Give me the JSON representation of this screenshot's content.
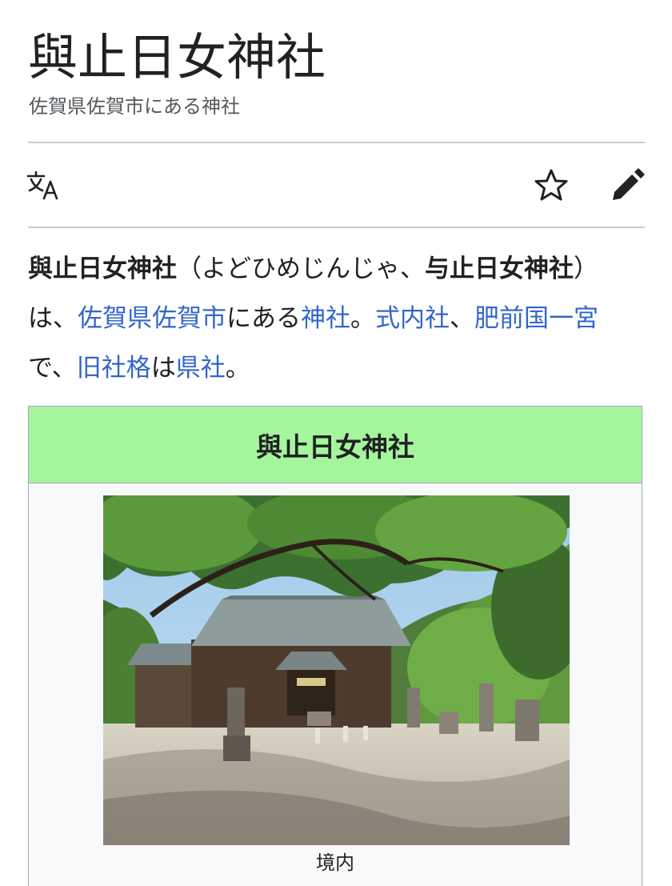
{
  "article": {
    "title": "與止日女神社",
    "description": "佐賀県佐賀市にある神社"
  },
  "toolbar": {
    "language_icon": "translate-icon",
    "watch_icon": "star-icon",
    "edit_icon": "pencil-icon"
  },
  "lead": {
    "t1": "與止日女神社",
    "t2": "（よどひめじんじゃ、",
    "t3": "与止日女神社",
    "t4": "）は、",
    "l1": "佐賀県佐賀市",
    "t5": "にある",
    "l2": "神社",
    "t6": "。",
    "l3": "式内社",
    "t7": "、",
    "l4": "肥前国一宮",
    "t8": "で、",
    "l5": "旧社格",
    "t9": "は",
    "l6": "県社",
    "t10": "。"
  },
  "infobox": {
    "title": "與止日女神社",
    "header_color": "#a4f59c",
    "caption": "境内"
  },
  "colors": {
    "link": "#3366cc",
    "text": "#202122",
    "muted": "#54595d"
  }
}
